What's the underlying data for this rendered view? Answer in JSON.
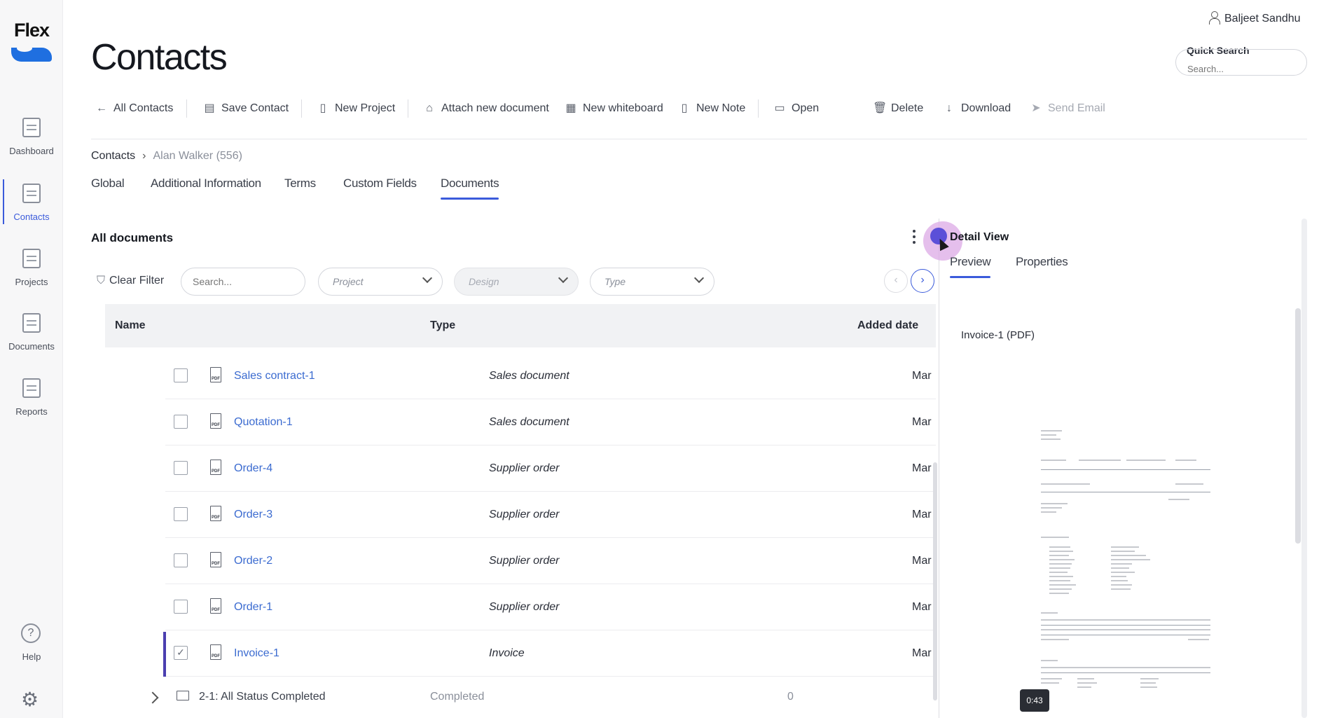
{
  "app": {
    "logo_text": "Flex",
    "brand_color": "#1f6fe0",
    "accent_color": "#3b5bdb"
  },
  "sidebar": {
    "items": [
      {
        "label": "Dashboard",
        "icon": "dashboard-icon"
      },
      {
        "label": "Contacts",
        "icon": "contacts-icon",
        "active": true
      },
      {
        "label": "Projects",
        "icon": "projects-icon"
      },
      {
        "label": "Documents",
        "icon": "documents-icon"
      },
      {
        "label": "Reports",
        "icon": "reports-icon"
      }
    ],
    "help_label": "Help",
    "help_glyph": "?"
  },
  "header": {
    "title": "Contacts",
    "user_name": "Baljeet Sandhu",
    "quick_search_label": "Quick Search",
    "quick_search_placeholder": "Search..."
  },
  "toolbar": {
    "all_contacts": "All Contacts",
    "save_contact": "Save Contact",
    "new_project": "New Project",
    "attach_document": "Attach new document",
    "new_whiteboard": "New whiteboard",
    "new_note": "New Note",
    "open": "Open",
    "delete": "Delete",
    "download": "Download",
    "send_email": "Send Email"
  },
  "breadcrumb": {
    "root": "Contacts",
    "current": "Alan Walker (556)"
  },
  "tabs": [
    "Global",
    "Additional Information",
    "Terms",
    "Custom Fields",
    "Documents"
  ],
  "documents": {
    "section_title": "All documents",
    "clear_filter": "Clear Filter",
    "search_placeholder": "Search...",
    "filter_project": "Project",
    "filter_design": "Design",
    "filter_type": "Type",
    "columns": {
      "name": "Name",
      "type": "Type",
      "added_date": "Added date"
    },
    "rows": [
      {
        "name": "Sales contract-1",
        "type": "Sales document",
        "date": "Mar",
        "checked": false
      },
      {
        "name": "Quotation-1",
        "type": "Sales document",
        "date": "Mar",
        "checked": false
      },
      {
        "name": "Order-4",
        "type": "Supplier order",
        "date": "Mar",
        "checked": false
      },
      {
        "name": "Order-3",
        "type": "Supplier order",
        "date": "Mar",
        "checked": false
      },
      {
        "name": "Order-2",
        "type": "Supplier order",
        "date": "Mar",
        "checked": false
      },
      {
        "name": "Order-1",
        "type": "Supplier order",
        "date": "Mar",
        "checked": false
      },
      {
        "name": "Invoice-1",
        "type": "Invoice",
        "date": "Mar",
        "checked": true
      }
    ],
    "file_icon_label": "PDF",
    "group_row": {
      "name": "2-1: All Status Completed",
      "status": "Completed",
      "count": "0"
    }
  },
  "detail_view": {
    "title": "Detail View",
    "tab_preview": "Preview",
    "tab_properties": "Properties",
    "file_label": "Invoice-1 (PDF)"
  },
  "video": {
    "timestamp": "0:43"
  }
}
